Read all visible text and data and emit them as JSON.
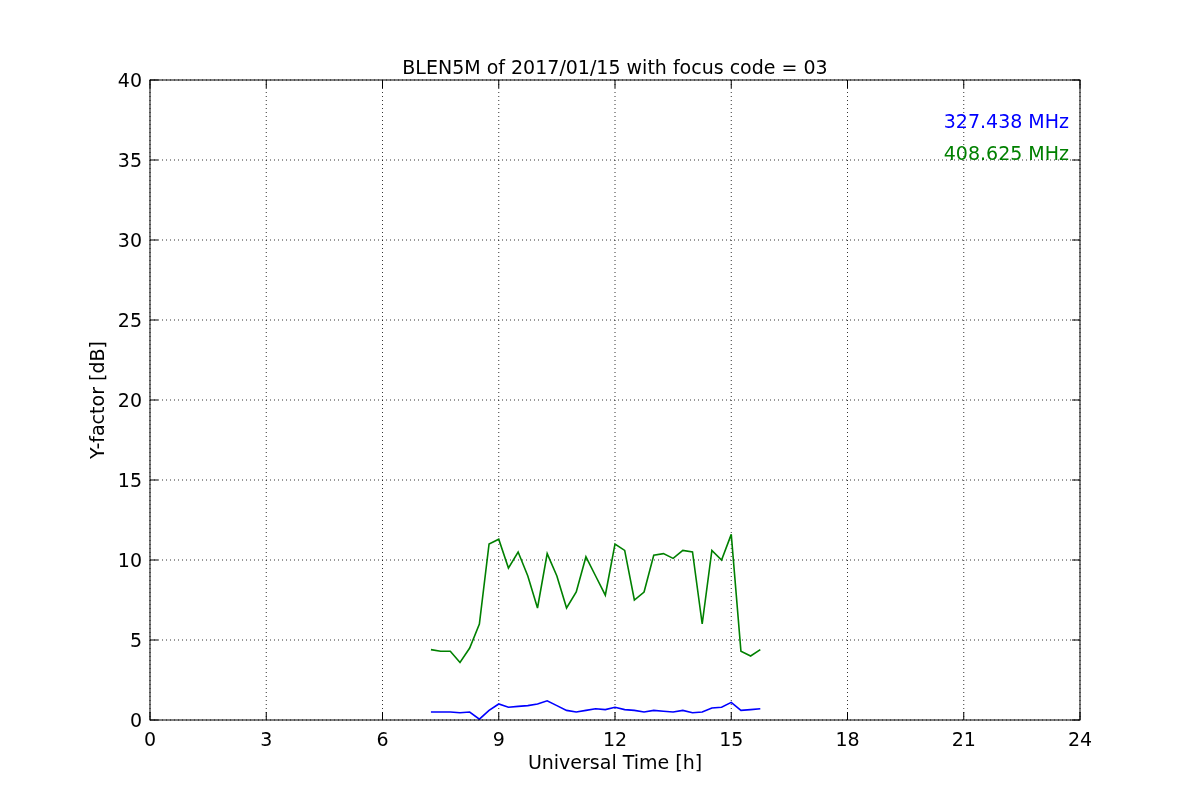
{
  "chart_data": {
    "type": "line",
    "title": "BLEN5M of 2017/01/15 with focus code = 03",
    "xlabel": "Universal Time [h]",
    "ylabel": "Y-factor [dB]",
    "x": [
      7.25,
      7.5,
      7.75,
      8,
      8.25,
      8.5,
      8.75,
      9,
      9.25,
      9.5,
      9.75,
      10,
      10.25,
      10.5,
      10.75,
      11,
      11.25,
      11.5,
      11.75,
      12,
      12.25,
      12.5,
      12.75,
      13,
      13.25,
      13.5,
      13.75,
      14,
      14.25,
      14.5,
      14.75,
      15,
      15.25,
      15.5,
      15.75
    ],
    "series": [
      {
        "name": "327.438 MHz",
        "color": "#0000ff",
        "values": [
          0.5,
          0.5,
          0.5,
          0.45,
          0.5,
          0.05,
          0.6,
          1.0,
          0.8,
          0.85,
          0.9,
          1.0,
          1.2,
          0.9,
          0.6,
          0.5,
          0.6,
          0.7,
          0.65,
          0.8,
          0.65,
          0.6,
          0.5,
          0.6,
          0.55,
          0.5,
          0.6,
          0.45,
          0.5,
          0.75,
          0.8,
          1.1,
          0.6,
          0.65,
          0.7
        ]
      },
      {
        "name": "408.625 MHz",
        "color": "#008000",
        "values": [
          4.4,
          4.3,
          4.3,
          3.6,
          4.5,
          6.0,
          11.0,
          11.3,
          9.5,
          10.5,
          9.0,
          7.0,
          10.4,
          9.0,
          7.0,
          8.0,
          10.2,
          9.0,
          7.8,
          11.0,
          10.6,
          7.5,
          8.0,
          10.3,
          10.4,
          10.1,
          10.6,
          10.5,
          6.0,
          10.6,
          10.0,
          11.6,
          4.3,
          4.0,
          4.4
        ]
      }
    ],
    "grid": true,
    "xlim": [
      0,
      24
    ],
    "ylim": [
      0,
      40
    ],
    "xticks": [
      0,
      3,
      6,
      9,
      12,
      15,
      18,
      21,
      24
    ],
    "yticks": [
      0,
      5,
      10,
      15,
      20,
      25,
      30,
      35,
      40
    ]
  }
}
